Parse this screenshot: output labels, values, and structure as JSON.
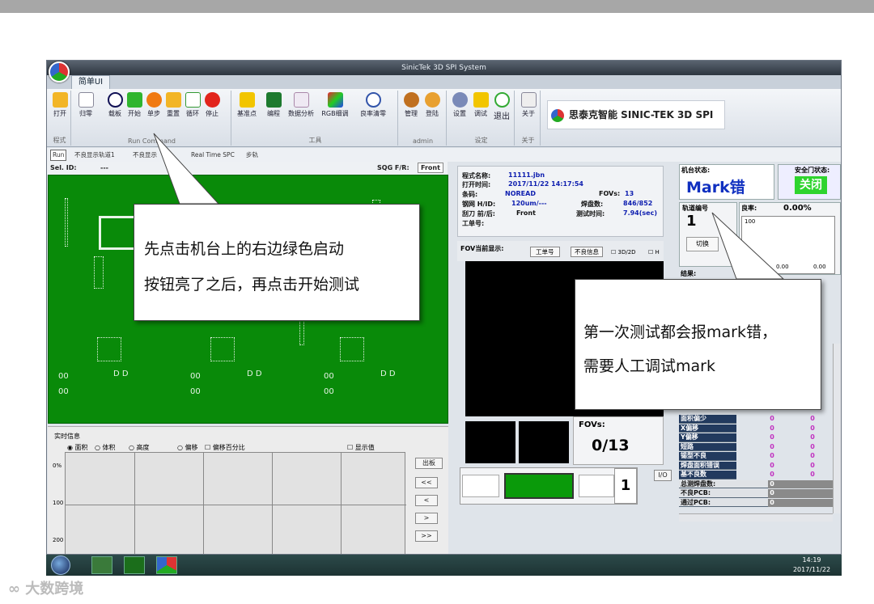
{
  "window": {
    "title": "SinicTek 3D SPI System",
    "tab": "简单UI"
  },
  "ribbon": {
    "groups": [
      {
        "label": "程式",
        "buttons": [
          "打开"
        ]
      },
      {
        "label": "Run Command",
        "buttons": [
          "归零",
          "载板",
          "开始",
          "单步",
          "重置",
          "循环",
          "停止"
        ]
      },
      {
        "label": "工具",
        "buttons": [
          "基准点",
          "编程",
          "数据分析",
          "RGB细调",
          "良率清零"
        ]
      },
      {
        "label": "admin",
        "buttons": [
          "管理",
          "登陆"
        ]
      },
      {
        "label": "设定",
        "buttons": [
          "设置",
          "调试",
          "退出"
        ]
      },
      {
        "label": "关于",
        "buttons": [
          "关于"
        ]
      }
    ],
    "brand": "思泰克智能 SINIC-TEK 3D SPI"
  },
  "status_row": {
    "run": "Run",
    "items": [
      "不良显示轨道1",
      "不良显示",
      "Real Time SPC",
      "步轨"
    ]
  },
  "sel_row": {
    "sel_id_label": "Sel. ID:",
    "sel_id_value": "---",
    "sqg_label": "SQG F/R:",
    "front": "Front"
  },
  "realtime": {
    "title": "实时信息",
    "radios": [
      "面积",
      "体积",
      "高度",
      "偏移"
    ],
    "check1": "偏移百分比",
    "check2": "显示值",
    "y_labels": [
      "0%",
      "100",
      "200"
    ],
    "buttons": [
      "出板",
      "<<",
      "<",
      ">",
      ">>"
    ]
  },
  "program_info": {
    "name_label": "程式名称:",
    "name": "11111.jbn",
    "open_label": "打开时间:",
    "open_time": "2017/11/22 14:17:54",
    "barcode_label": "条码:",
    "barcode": "NOREAD",
    "fovs_label": "FOVs:",
    "fovs": "13",
    "hid_label": "钢网 H/ID:",
    "hid": "120um/---",
    "joints_label": "焊盘数:",
    "joints": "846/852",
    "squeegee_label": "刮刀 前/后:",
    "squeegee": "Front",
    "testtime_label": "测试时间:",
    "testtime": "7.94(sec)",
    "workorder_label": "工单号:"
  },
  "fov_display": {
    "label": "FOV当前显示:",
    "btn_workorder": "工单号",
    "btn_defect": "不良信息",
    "check_3d": "3D/2D",
    "check_h": "H"
  },
  "fov_counter": {
    "label": "FOVs:",
    "value": "0/13"
  },
  "conveyor": {
    "count": "1",
    "io": "I/O"
  },
  "machine": {
    "state_label": "机台状态:",
    "state": "Mark错",
    "door_label": "安全门状态:",
    "door": "关闭"
  },
  "track": {
    "label": "轨道编号",
    "value": "1",
    "switch": "切换"
  },
  "yield": {
    "label": "良率:",
    "value": "0.00%",
    "axis_top": "100",
    "v1": "0.00",
    "v2": "0.00"
  },
  "result_label": "结果:",
  "defects": {
    "rows": [
      {
        "name": "面积偏少",
        "v1": "0",
        "v2": "0"
      },
      {
        "name": "X偏移",
        "v1": "0",
        "v2": "0"
      },
      {
        "name": "Y偏移",
        "v1": "0",
        "v2": "0"
      },
      {
        "name": "短路",
        "v1": "0",
        "v2": "0"
      },
      {
        "name": "锡型不良",
        "v1": "0",
        "v2": "0"
      },
      {
        "name": "焊盘面积错误",
        "v1": "0",
        "v2": "0"
      },
      {
        "name": "基不良数",
        "v1": "0",
        "v2": "0"
      },
      {
        "name": "总测焊盘数:",
        "v1": "0",
        "v2": ""
      },
      {
        "name": "不良PCB:",
        "v1": "0",
        "v2": ""
      },
      {
        "name": "通过PCB:",
        "v1": "0",
        "v2": ""
      }
    ]
  },
  "taskbar": {
    "time": "14:19",
    "date": "2017/11/22"
  },
  "callouts": {
    "left_line1": "先点击机台上的右边绿色启动",
    "left_line2": "按钮亮了之后，再点击开始测试",
    "right_line1": "第一次测试都会报mark错，",
    "right_line2": "需要人工调试mark"
  },
  "watermark": "大数跨境",
  "colors": {
    "pcb": "#098a09",
    "mark_error": "#1030c0",
    "door_ok": "#2ed42e",
    "defect_header": "#223a5e"
  }
}
